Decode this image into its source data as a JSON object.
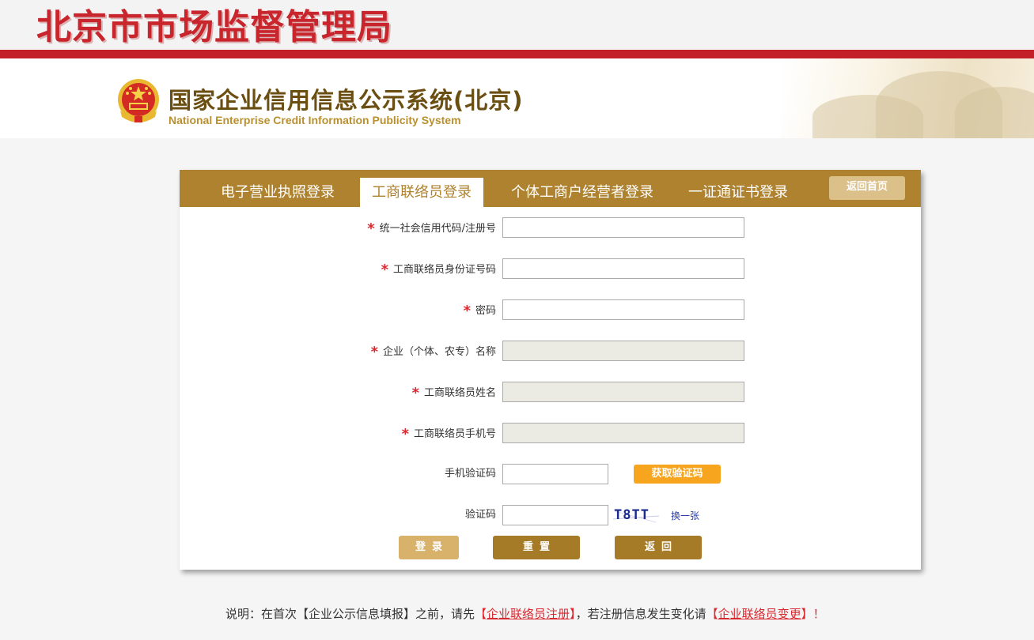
{
  "bureau_title": "北京市市场监督管理局",
  "system": {
    "title": "国家企业信用信息公示系统(北京)",
    "subtitle": "National Enterprise Credit Information Publicity System"
  },
  "tabs": [
    {
      "label": "电子营业执照登录",
      "active": false
    },
    {
      "label": "工商联络员登录",
      "active": true
    },
    {
      "label": "个体工商户经营者登录",
      "active": false
    },
    {
      "label": "一证通证书登录",
      "active": false
    }
  ],
  "home_button": "返回首页",
  "required_mark": "*",
  "form": {
    "credit_code": {
      "label": "统一社会信用代码/注册号",
      "value": "",
      "required": true
    },
    "liaison_id": {
      "label": "工商联络员身份证号码",
      "value": "",
      "required": true
    },
    "password": {
      "label": "密码",
      "value": "",
      "required": true
    },
    "company_name": {
      "label": "企业（个体、农专）名称",
      "value": "",
      "required": true,
      "readonly": true
    },
    "liaison_name": {
      "label": "工商联络员姓名",
      "value": "",
      "required": true,
      "readonly": true
    },
    "liaison_phone": {
      "label": "工商联络员手机号",
      "value": "",
      "required": true,
      "readonly": true
    },
    "sms_code": {
      "label": "手机验证码",
      "value": "",
      "required": false,
      "button": "获取验证码"
    },
    "captcha": {
      "label": "验证码",
      "value": "",
      "required": false,
      "image_text": "T8TT",
      "refresh": "换一张"
    }
  },
  "buttons": {
    "login": "登录",
    "reset": "重置",
    "back": "返回"
  },
  "footer": {
    "prefix": "说明：在首次【企业公示信息填报】之前，请先",
    "open1": "【",
    "link1": "企业联络员注册",
    "close1": "】",
    "middle": "，若注册信息发生变化请",
    "open2": "【",
    "link2": "企业联络员变更",
    "close2": "】！"
  },
  "colors": {
    "brand_red": "#c21f28",
    "gold": "#ae822f",
    "orange": "#f7a51f",
    "required": "#d9282f"
  }
}
